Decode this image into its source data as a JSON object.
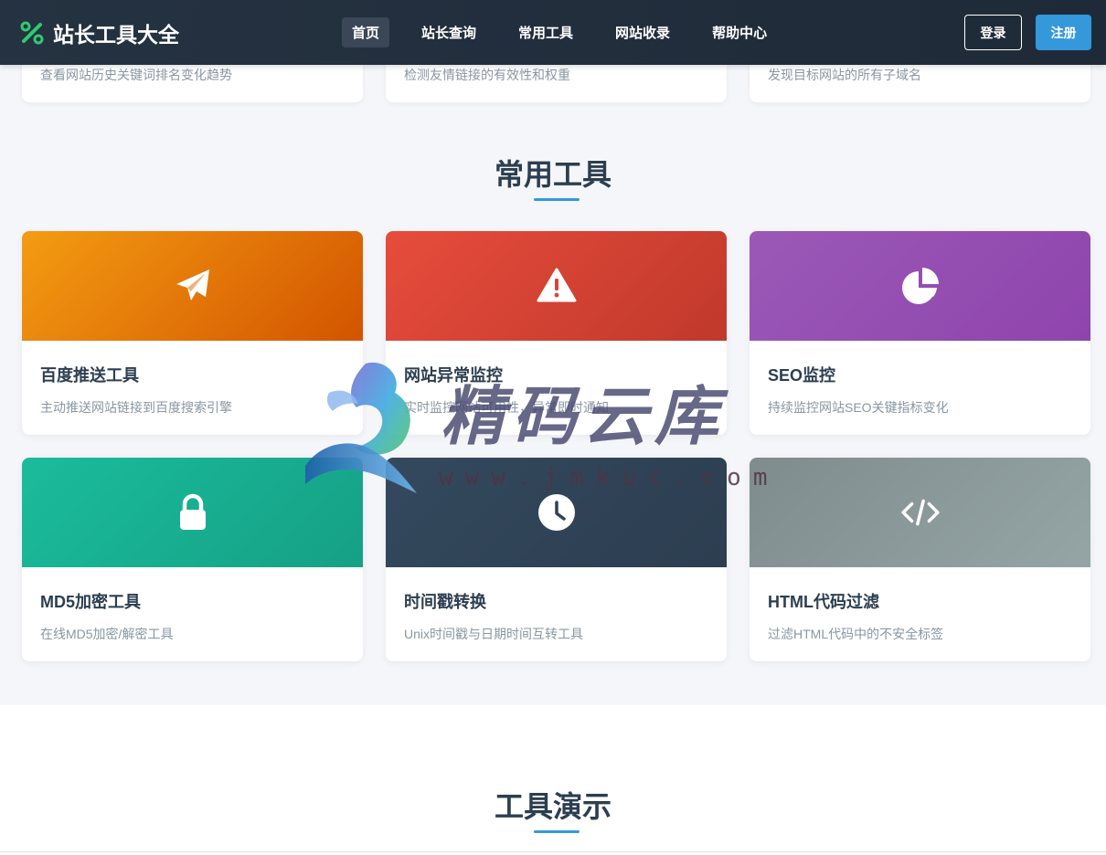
{
  "header": {
    "logo_text": "站长工具大全",
    "logo_icon": "tools-icon",
    "nav": [
      {
        "label": "首页",
        "active": true
      },
      {
        "label": "站长查询",
        "active": false
      },
      {
        "label": "常用工具",
        "active": false
      },
      {
        "label": "网站收录",
        "active": false
      },
      {
        "label": "帮助中心",
        "active": false
      }
    ],
    "login_label": "登录",
    "register_label": "注册"
  },
  "top_cards": [
    {
      "desc": "查看网站历史关键词排名变化趋势"
    },
    {
      "desc": "检测友情链接的有效性和权重"
    },
    {
      "desc": "发现目标网站的所有子域名"
    }
  ],
  "common_tools": {
    "title": "常用工具",
    "items": [
      {
        "name": "百度推送工具",
        "desc": "主动推送网站链接到百度搜索引擎",
        "icon": "paper-plane-icon",
        "color": "#e67e22"
      },
      {
        "name": "网站异常监控",
        "desc": "实时监控网站可用性，异常即时通知",
        "icon": "warning-icon",
        "color": "#e74c3c"
      },
      {
        "name": "SEO监控",
        "desc": "持续监控网站SEO关键指标变化",
        "icon": "pie-chart-icon",
        "color": "#9b59b6"
      },
      {
        "name": "MD5加密工具",
        "desc": "在线MD5加密/解密工具",
        "icon": "lock-icon",
        "color": "#1abc9c"
      },
      {
        "name": "时间戳转换",
        "desc": "Unix时间戳与日期时间互转工具",
        "icon": "clock-icon",
        "color": "#34495e"
      },
      {
        "name": "HTML代码过滤",
        "desc": "过滤HTML代码中的不安全标签",
        "icon": "code-icon",
        "color": "#95a5a6"
      }
    ]
  },
  "demo_section": {
    "title": "工具演示"
  },
  "watermark": {
    "text": "精码云库",
    "url": "www.jmkuc.com"
  }
}
